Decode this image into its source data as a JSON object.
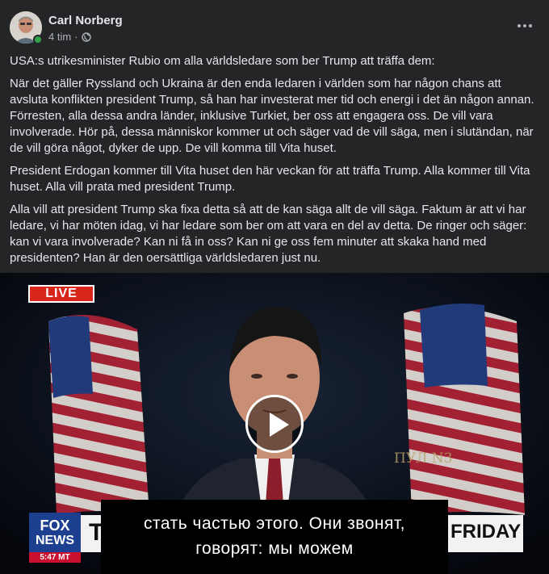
{
  "post": {
    "author": "Carl Norberg",
    "time": "4 tim",
    "separator": "·",
    "privacy_icon": "globe-icon",
    "more_icon": "more-horizontal-icon",
    "paragraphs": [
      "USA:s utrikesminister Rubio om alla världsledare som ber Trump att träffa dem:",
      "När det gäller Ryssland och Ukraina är den enda ledaren i världen som har någon chans att avsluta konflikten president Trump, så han har investerat mer tid och energi i det än någon annan. Förresten, alla dessa andra länder, inklusive Turkiet, ber oss att engagera oss. De vill vara involverade. Hör på, dessa människor kommer ut och säger vad de vill säga, men i slutändan, när de vill göra något, dyker de upp. De vill komma till Vita huset.",
      "President Erdogan kommer till Vita huset den här veckan för att träffa Trump. Alla kommer till Vita huset. Alla vill prata med president Trump.",
      "Alla vill att president Trump ska fixa detta så att de kan säga allt de vill säga. Faktum är att vi har ledare, vi har möten idag, vi har ledare som ber om att vara en del av detta. De ringer och säger: kan vi vara involverade? Kan ni få in oss? Kan ni ge oss fem minuter att skaka hand med presidenten? Han är den oersättliga världsledaren just nu."
    ]
  },
  "video": {
    "live_badge": "LIVE",
    "watermark": "ПУЛ N3",
    "network_line1": "FOX",
    "network_line2": "NEWS",
    "time": "5:47 MT",
    "chyron_left": "T",
    "chyron_right": "FRIDAY",
    "subtitle_line1": "стать частью этого. Они звонят,",
    "subtitle_line2": "говорят: мы можем",
    "play_icon": "play-icon",
    "colors": {
      "live_red": "#d9261c",
      "fox_blue": "#1c3f8f",
      "flag_red": "#b22234"
    }
  }
}
